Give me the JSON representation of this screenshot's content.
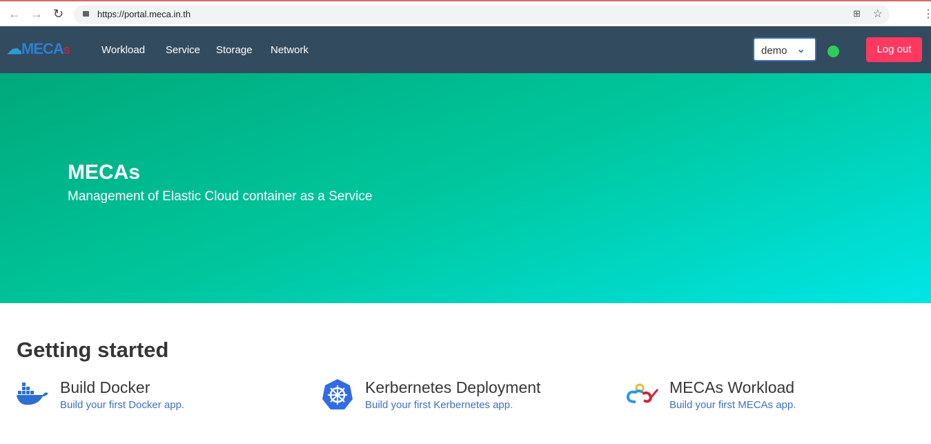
{
  "browser": {
    "url": "https://portal.meca.in.th"
  },
  "navbar": {
    "logo": "MECAs",
    "links": [
      "Workload",
      "Service",
      "Storage",
      "Network"
    ],
    "namespace": "demo",
    "status_color": "#2ecc5a",
    "logout": "Log out"
  },
  "hero": {
    "title": "MECAs",
    "subtitle": "Management of Elastic Cloud container as a Service"
  },
  "getting_started": {
    "heading": "Getting started",
    "cards": [
      {
        "title": "Build Docker",
        "desc": "Build your first Docker app.",
        "icon": "docker-icon"
      },
      {
        "title": "Kerbernetes Deployment",
        "desc": "Build your first Kerbernetes app.",
        "icon": "kubernetes-icon"
      },
      {
        "title": "MECAs Workload",
        "desc": "Build your first MECAs app.",
        "icon": "mecas-cloud-icon"
      }
    ]
  }
}
